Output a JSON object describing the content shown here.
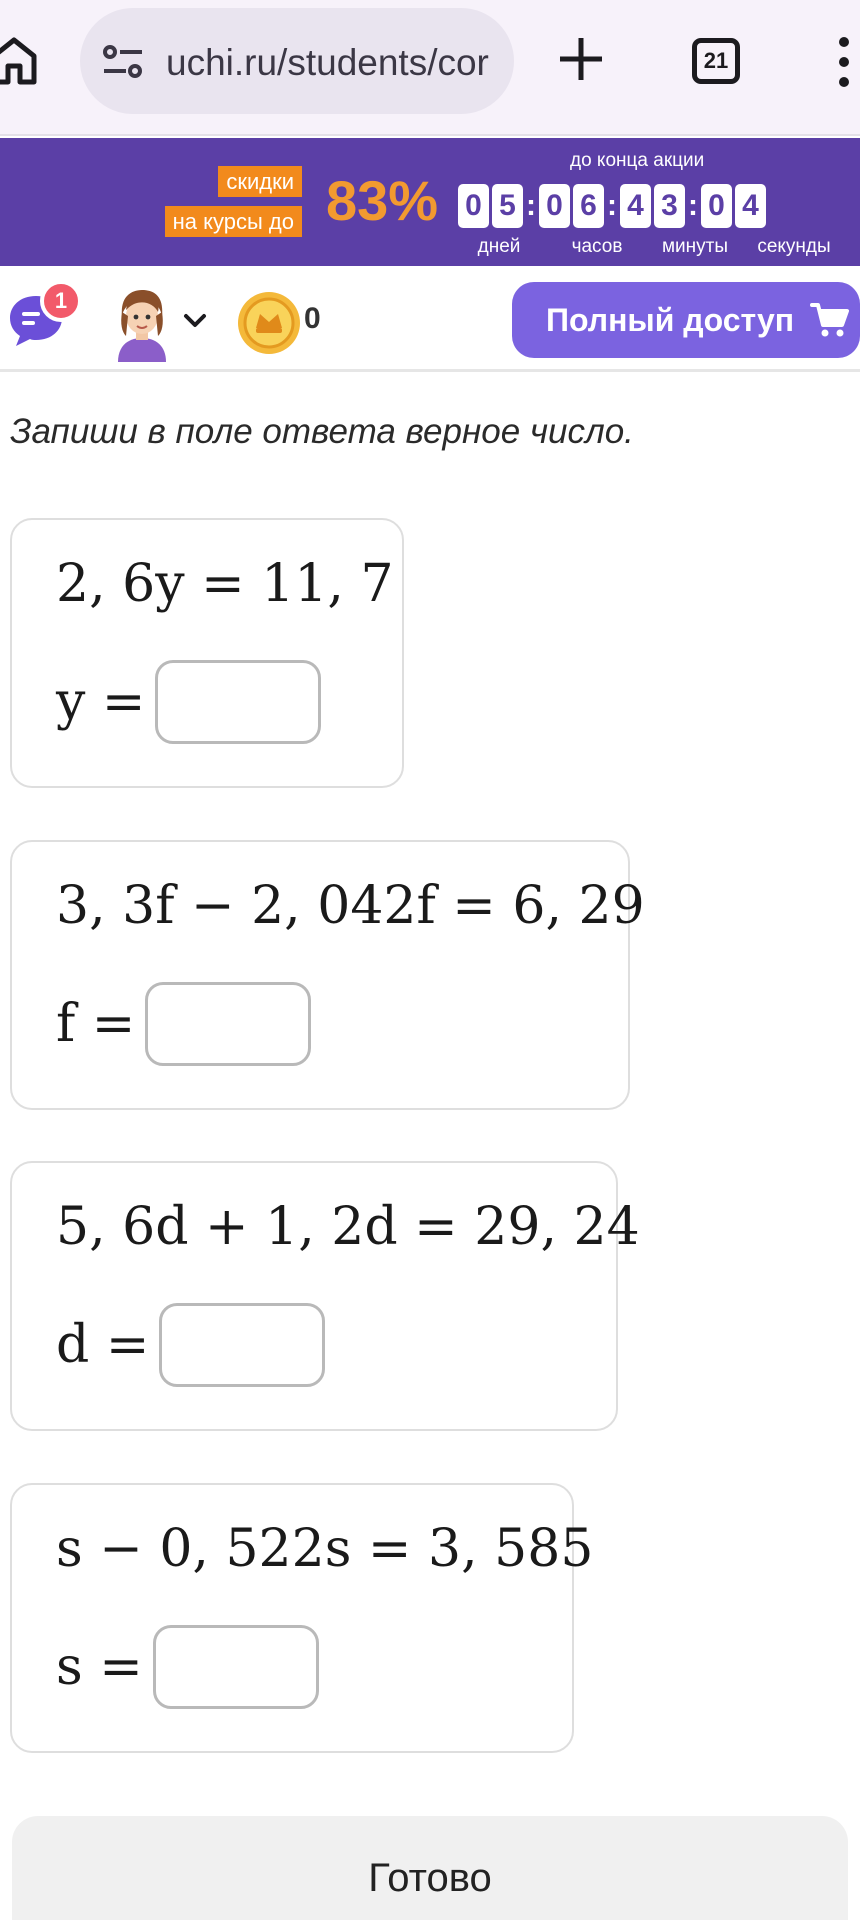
{
  "browser": {
    "url": "uchi.ru/students/cor",
    "tab_count": "21",
    "icons": [
      "home-icon",
      "site-settings-icon",
      "add-tab-icon",
      "tab-switcher-icon",
      "more-vert-icon"
    ]
  },
  "promo": {
    "tag_line1": "скидки",
    "tag_line2": "на курсы до",
    "percent": "83%",
    "until_label": "до конца акции",
    "timer": {
      "days": [
        "0",
        "5"
      ],
      "hours": [
        "0",
        "6"
      ],
      "minutes": [
        "4",
        "3"
      ],
      "seconds": [
        "0",
        "4"
      ],
      "separator": ":"
    },
    "units": {
      "days": "дней",
      "hours": "часов",
      "minutes": "минуты",
      "seconds": "секунды"
    },
    "colors": {
      "background": "#5b3fa6",
      "accent": "#f29a30",
      "tag": "#f28a1c"
    }
  },
  "header": {
    "notification_count": "1",
    "coins": "0",
    "full_access_label": "Полный доступ",
    "icons": [
      "chat-icon",
      "avatar",
      "chevron-down-icon",
      "coin-icon",
      "cart-icon"
    ],
    "accent_color": "#7b63e0"
  },
  "task": {
    "instruction": "Запиши в поле ответа верное число.",
    "problems": [
      {
        "equation": "2, 6y = 11, 7",
        "variable": "y =",
        "answer": ""
      },
      {
        "equation": "3, 3f − 2, 042f = 6, 29",
        "variable": "f =",
        "answer": ""
      },
      {
        "equation": "5, 6d + 1, 2d = 29, 24",
        "variable": "d =",
        "answer": ""
      },
      {
        "equation": "s − 0, 522s = 3, 585",
        "variable": "s =",
        "answer": ""
      }
    ],
    "done_label": "Готово"
  }
}
